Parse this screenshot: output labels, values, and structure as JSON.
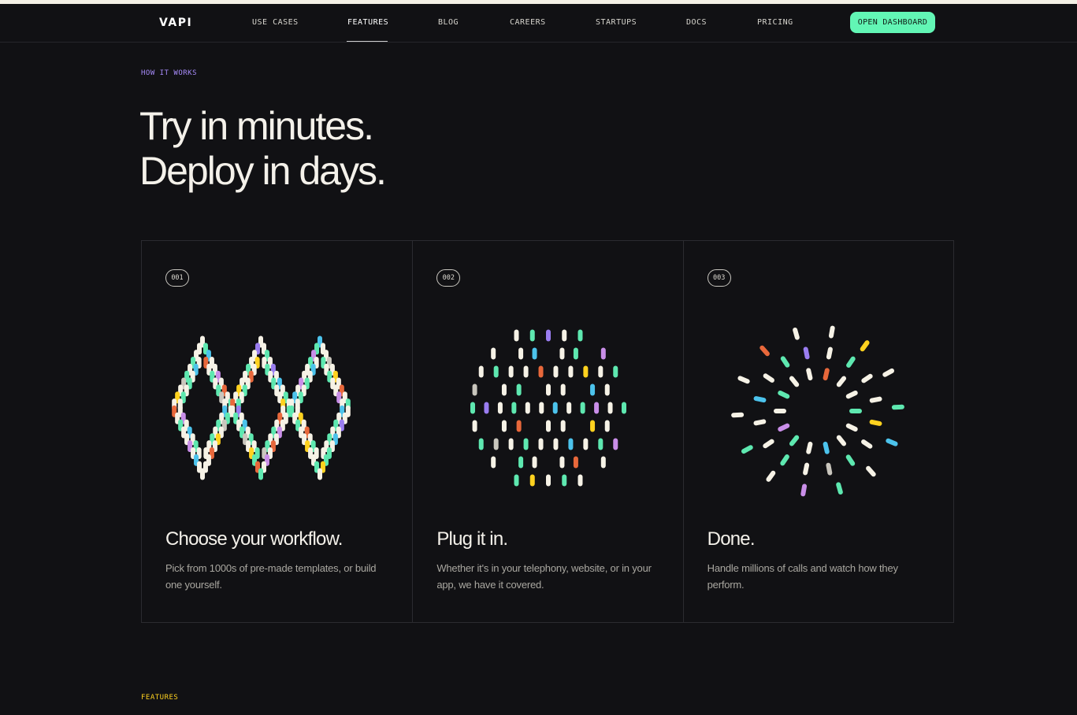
{
  "brand": {
    "logo_text": "VAPI"
  },
  "nav": {
    "items": [
      {
        "label": "USE CASES",
        "active": false
      },
      {
        "label": "FEATURES",
        "active": true
      },
      {
        "label": "BLOG",
        "active": false
      },
      {
        "label": "CAREERS",
        "active": false
      },
      {
        "label": "STARTUPS",
        "active": false
      },
      {
        "label": "DOCS",
        "active": false
      },
      {
        "label": "PRICING",
        "active": false
      }
    ],
    "cta_label": "OPEN DASHBOARD"
  },
  "section": {
    "eyebrow": "HOW IT WORKS",
    "headline_line1": "Try in minutes.",
    "headline_line2": "Deploy in days."
  },
  "cards": [
    {
      "number": "001",
      "title": "Choose your workflow.",
      "description": "Pick from 1000s of pre-made templates, or build one yourself.",
      "illustration": "diamond-pattern"
    },
    {
      "number": "002",
      "title": "Plug it in.",
      "description": "Whether it's in your telephony, website, or in your app, we have it covered.",
      "illustration": "grid-circle-pattern"
    },
    {
      "number": "003",
      "title": "Done.",
      "description": "Handle millions of calls and watch how they perform.",
      "illustration": "radial-burst-pattern"
    }
  ],
  "next_section": {
    "eyebrow": "FEATURES"
  },
  "colors": {
    "background": "#111114",
    "accent_green": "#62f6b5",
    "eyebrow_purple": "#a78bfa",
    "eyebrow_yellow": "#ffd21f",
    "dash_palette": [
      "#f6f2e6",
      "#5ee8b0",
      "#e8683b",
      "#4cc3ec",
      "#ffd21f",
      "#c98ee8",
      "#9a7df0",
      "#b7f04a",
      "#c9c6bd"
    ]
  }
}
